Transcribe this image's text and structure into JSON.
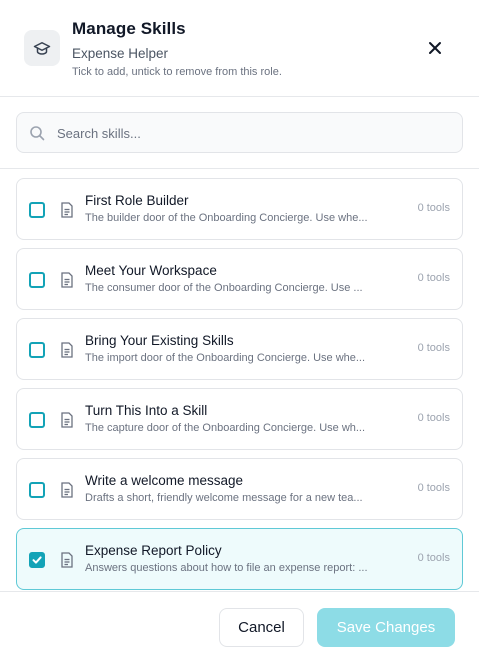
{
  "header": {
    "icon": "graduation-cap-icon",
    "title": "Manage Skills",
    "subtitle": "Expense Helper",
    "hint": "Tick to add, untick to remove from this role.",
    "close_icon": "close-icon"
  },
  "search": {
    "placeholder": "Search skills...",
    "value": "",
    "icon": "search-icon"
  },
  "skills": [
    {
      "title": "First Role Builder",
      "description": "The builder door of the Onboarding Concierge. Use whe...",
      "tools": "0 tools",
      "checked": false
    },
    {
      "title": "Meet Your Workspace",
      "description": "The consumer door of the Onboarding Concierge. Use ...",
      "tools": "0 tools",
      "checked": false
    },
    {
      "title": "Bring Your Existing Skills",
      "description": "The import door of the Onboarding Concierge. Use whe...",
      "tools": "0 tools",
      "checked": false
    },
    {
      "title": "Turn This Into a Skill",
      "description": "The capture door of the Onboarding Concierge. Use wh...",
      "tools": "0 tools",
      "checked": false
    },
    {
      "title": "Write a welcome message",
      "description": "Drafts a short, friendly welcome message for a new tea...",
      "tools": "0 tools",
      "checked": false
    },
    {
      "title": "Expense Report Policy",
      "description": "Answers questions about how to file an expense report: ...",
      "tools": "0 tools",
      "checked": true
    }
  ],
  "footer": {
    "cancel_label": "Cancel",
    "save_label": "Save Changes",
    "save_enabled": false
  },
  "colors": {
    "accent": "#13a3b7",
    "accent_light": "#8ddce6",
    "selected_bg": "#eefbfc",
    "selected_border": "#5fc9d6"
  }
}
